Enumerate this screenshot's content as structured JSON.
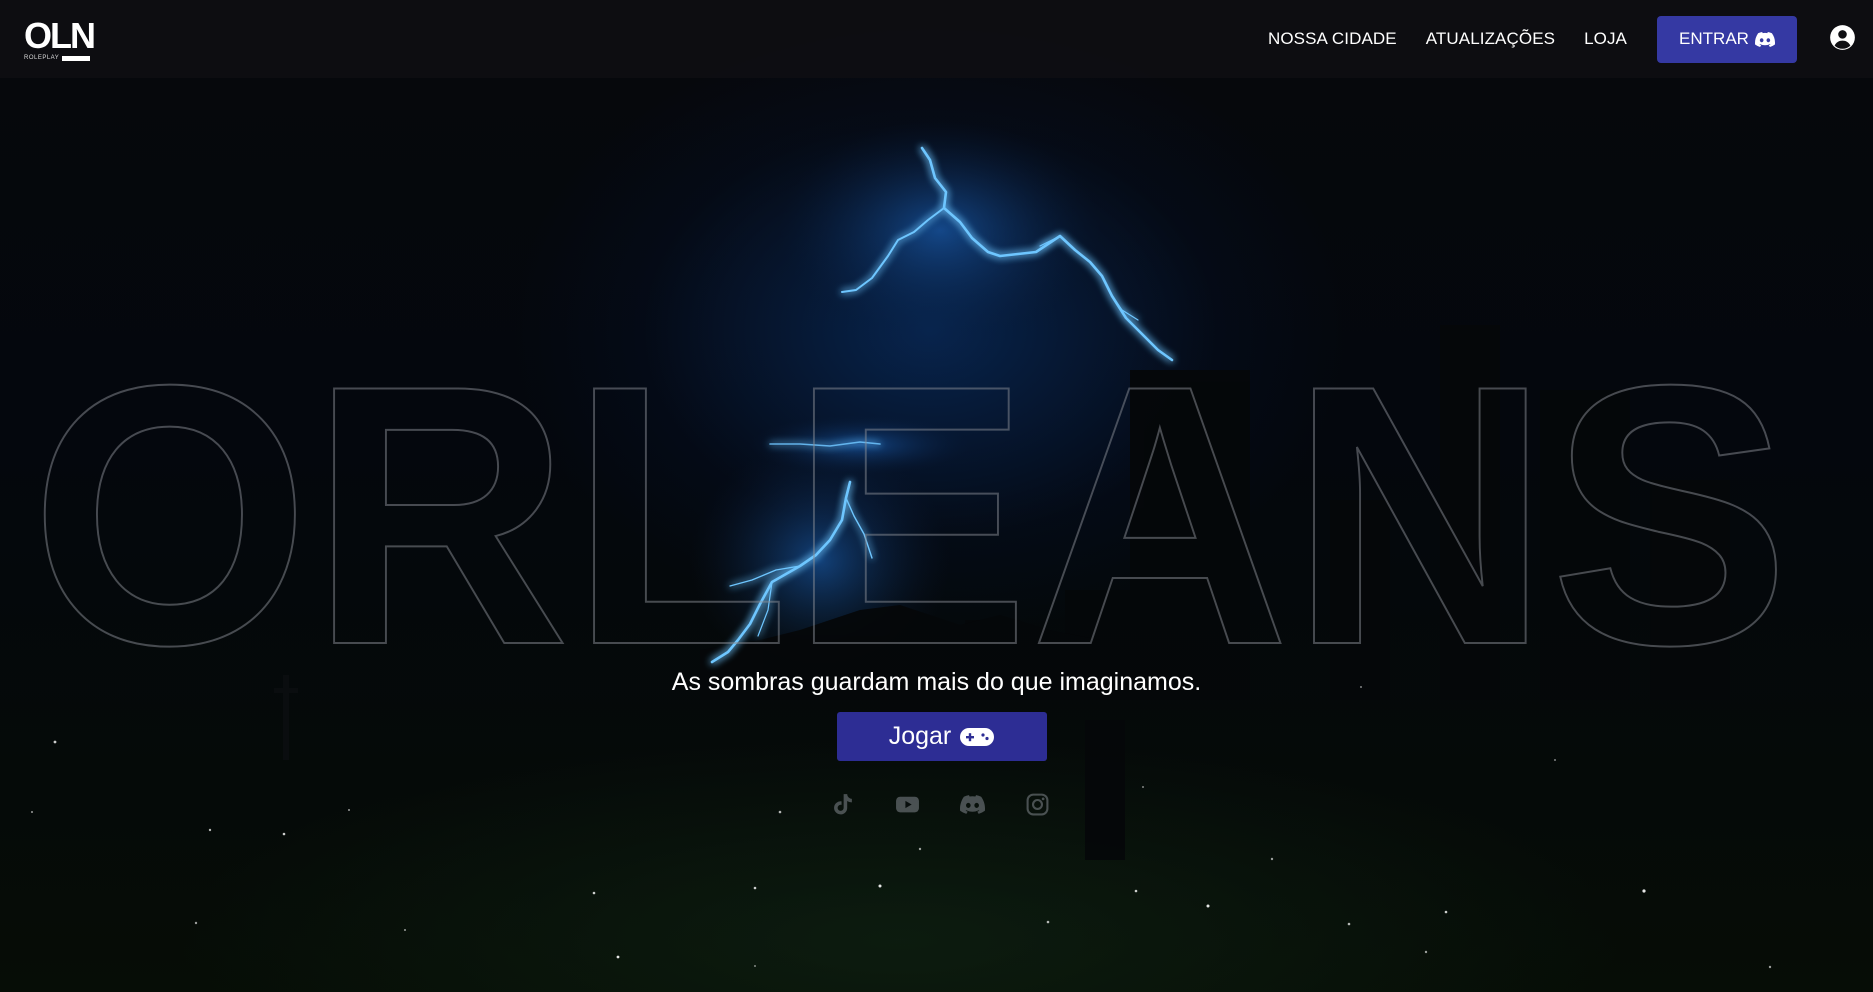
{
  "header": {
    "logo_text": "OLN",
    "logo_subtext": "ROLEPLAY",
    "nav": [
      "NOSSA CIDADE",
      "ATUALIZAÇÕES",
      "LOJA"
    ],
    "login_label": "ENTRAR"
  },
  "hero": {
    "brand_word": "ORLEANS",
    "tagline": "As sombras guardam mais do que imaginamos.",
    "play_label": "Jogar"
  },
  "socials": [
    "tiktok-icon",
    "youtube-icon",
    "discord-icon",
    "instagram-icon"
  ],
  "colors": {
    "accent": "#3539a3",
    "play_button": "#2d2d94",
    "navbar": "#0e0e12",
    "lightning": "#4fb4ff"
  }
}
